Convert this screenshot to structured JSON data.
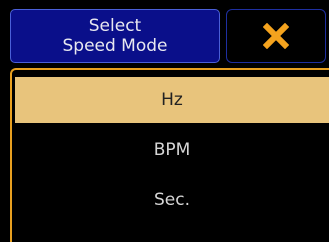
{
  "dialog": {
    "title": "Select\nSpeed Mode",
    "close_icon": "close-x-icon"
  },
  "options": [
    {
      "label": "Hz",
      "selected": true
    },
    {
      "label": "BPM",
      "selected": false
    },
    {
      "label": "Sec.",
      "selected": false
    }
  ],
  "colors": {
    "title_bg": "#0a0f8a",
    "accent": "#e8a020",
    "selected_bg": "#e8c47c",
    "close_x": "#f4a31e"
  }
}
